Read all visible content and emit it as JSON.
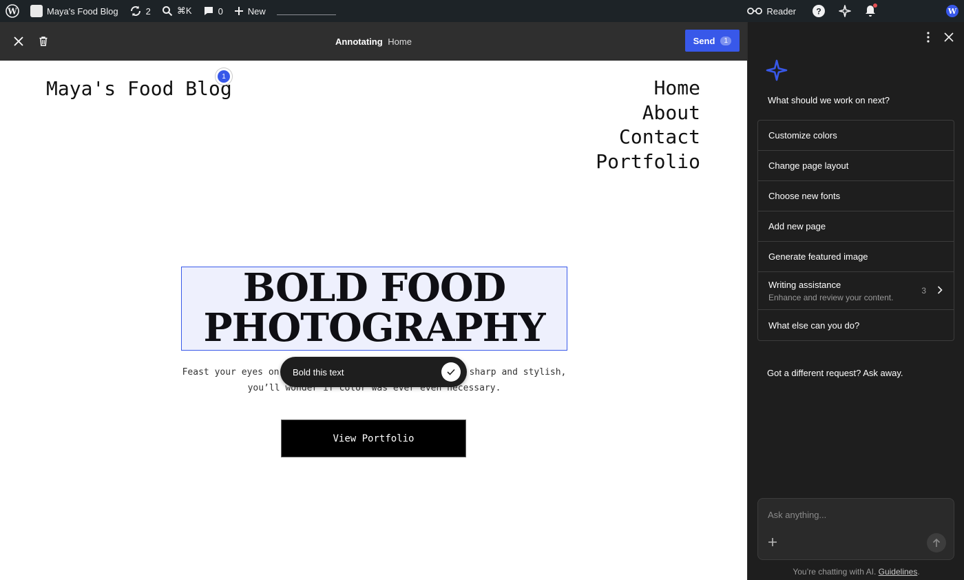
{
  "admin_bar": {
    "site_name": "Maya's Food Blog",
    "updates_count": "2",
    "search_shortcut": "⌘K",
    "comments_count": "0",
    "new_label": "New",
    "reader_label": "Reader"
  },
  "toolbar": {
    "mode_label": "Annotating",
    "page_label": "Home",
    "send_label": "Send",
    "send_count": "1"
  },
  "canvas": {
    "site_title": "Maya's Food Blog",
    "annotation_pin": "1",
    "nav": [
      "Home",
      "About",
      "Contact",
      "Portfolio"
    ],
    "hero_title_line1": "BOLD FOOD",
    "hero_title_line2": "PHOTOGRAPHY",
    "hero_text_before": "Feast your eyes on",
    "hero_text_after": "sharp and stylish,",
    "hero_text_line2": "you’ll wonder if color was ever even necessary.",
    "cta_label": "View Portfolio",
    "annotation_popover_text": "Bold this text"
  },
  "panel": {
    "question": "What should we work on next?",
    "suggestions": [
      {
        "label": "Customize colors"
      },
      {
        "label": "Change page layout"
      },
      {
        "label": "Choose new fonts"
      },
      {
        "label": "Add new page"
      },
      {
        "label": "Generate featured image"
      },
      {
        "label": "Writing assistance",
        "sub": "Enhance and review your content.",
        "count": "3"
      },
      {
        "label": "What else can you do?"
      }
    ],
    "ask_prompt": "Got a different request? Ask away.",
    "chat_placeholder": "Ask anything...",
    "disclaimer_text": "You’re chatting with AI.",
    "disclaimer_link": "Guidelines"
  },
  "colors": {
    "accent": "#3858e9",
    "admin_bar_bg": "#1d2327",
    "panel_bg": "#1e1e1e",
    "selection_bg": "#eef0fd",
    "notification_dot": "#e65054"
  }
}
